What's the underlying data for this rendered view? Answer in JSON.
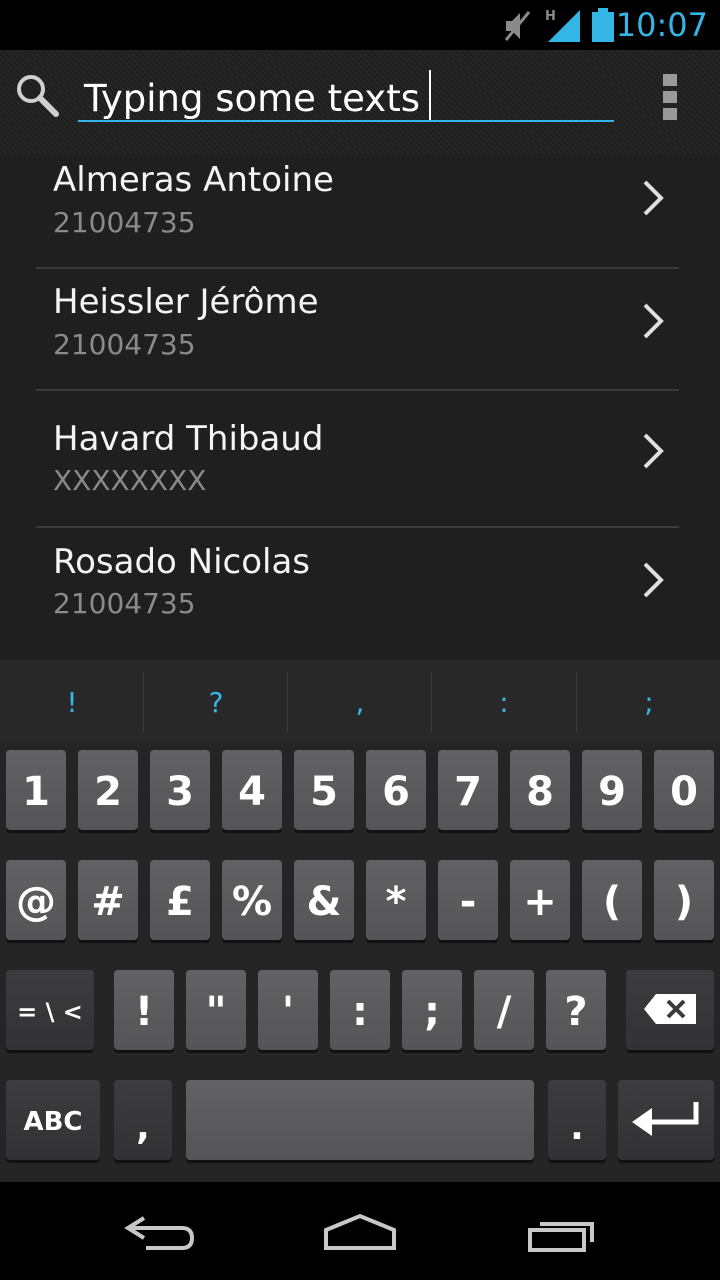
{
  "status_bar": {
    "time": "10:07",
    "network_type": "H",
    "icons": [
      "mute-icon",
      "signal-icon",
      "battery-icon"
    ],
    "accent_color": "#33b5e5"
  },
  "search": {
    "value": "Typing some texts",
    "icons": [
      "search-icon",
      "overflow-menu-icon"
    ]
  },
  "contacts": [
    {
      "name": "Almeras Antoine",
      "number": "21004735"
    },
    {
      "name": "Heissler Jérôme",
      "number": "21004735"
    },
    {
      "name": "Havard Thibaud",
      "number": "XXXXXXXX"
    },
    {
      "name": "Rosado Nicolas",
      "number": "21004735"
    }
  ],
  "keyboard": {
    "suggestions": [
      "!",
      "?",
      ",",
      ":",
      ";"
    ],
    "row1": [
      "1",
      "2",
      "3",
      "4",
      "5",
      "6",
      "7",
      "8",
      "9",
      "0"
    ],
    "row2": [
      "@",
      "#",
      "£",
      "%",
      "&",
      "*",
      "-",
      "+",
      "(",
      ")"
    ],
    "row3": [
      "!",
      "\"",
      "'",
      ":",
      ";",
      "/",
      "?"
    ],
    "shift_label": "= \\ <",
    "abc_label": "ABC",
    "comma_label": ",",
    "period_label": ".",
    "icons": [
      "backspace-icon",
      "enter-icon"
    ]
  },
  "nav_bar": {
    "icons": [
      "back-icon",
      "home-icon",
      "recent-apps-icon"
    ]
  }
}
